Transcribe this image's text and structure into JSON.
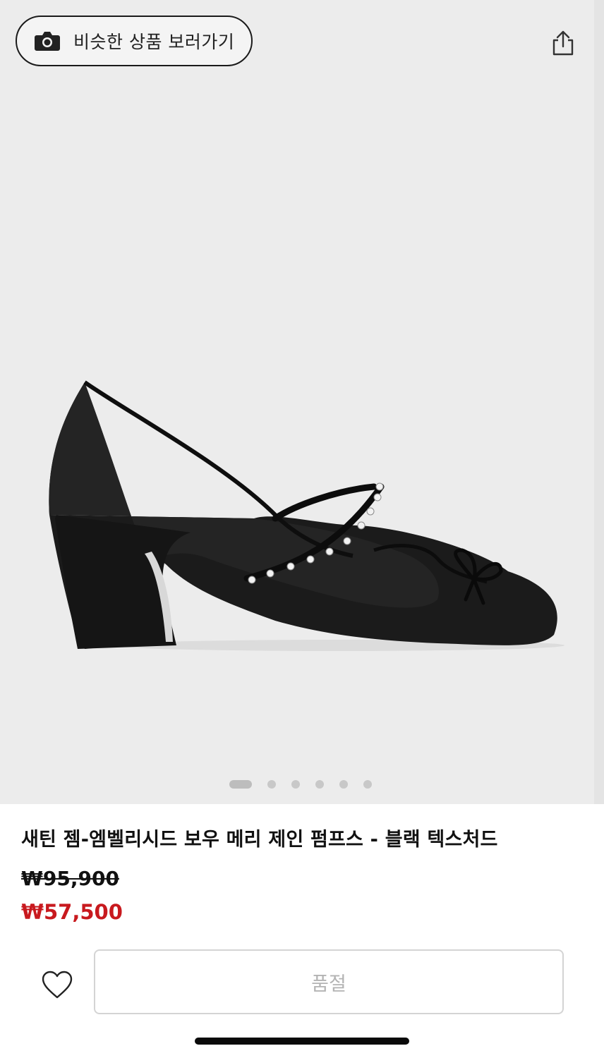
{
  "similar_button": {
    "label": "비슷한 상품 보러가기",
    "icon": "camera-icon"
  },
  "share": {
    "icon": "share-icon"
  },
  "gallery": {
    "image": "black satin mary jane pump with crystal-embellished strap and bow",
    "total_images": 6,
    "current_index": 1
  },
  "product": {
    "title": "새틴 젬-엠벨리시드 보우 메리 제인 펌프스 - 블랙 텍스처드",
    "original_price": "₩95,900",
    "sale_price": "₩57,500"
  },
  "actions": {
    "wishlist_icon": "heart-icon",
    "soldout_label": "품절"
  },
  "colors": {
    "sale": "#c8191e",
    "background": "#ececec",
    "border": "#d4d4d4"
  }
}
